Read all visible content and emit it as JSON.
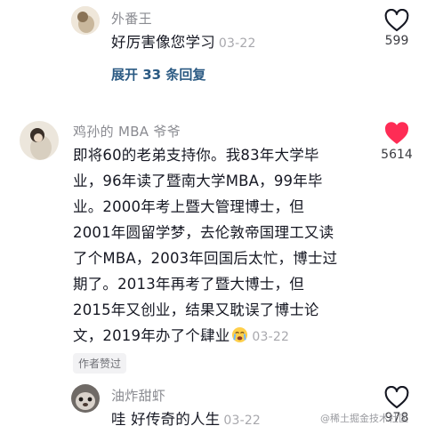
{
  "comments": [
    {
      "username": "外番王",
      "text": "好厉害像您学习",
      "time": "03-22",
      "likes": "599",
      "liked": false,
      "expand_label": "展开 33 条回复"
    },
    {
      "username": "鸡孙的 MBA 爷爷",
      "lines": [
        "即将60的老弟支持你。我83年大学毕",
        "业，96年读了暨南大学MBA，99年毕",
        "业。2000年考上暨大管理博士，但",
        "2001年圆留学梦，去伦敦帝国理工又读",
        "了个MBA，2003年回国后太忙，博士过",
        "期了。2013年再考了暨大博士，但",
        "2015年又创业，结果又耽误了博士论",
        "文，2019年办了个肆业"
      ],
      "time": "03-22",
      "likes": "5614",
      "liked": true,
      "author_badge": "作者赞过"
    },
    {
      "username": "油炸甜虾",
      "text": "哇 好传奇的人生",
      "time": "03-22",
      "likes": "978",
      "liked": false
    }
  ],
  "watermark": "@稀土掘金技术社区",
  "colors": {
    "liked_heart": "#fe2c55",
    "expand_link": "#2b5a83"
  }
}
